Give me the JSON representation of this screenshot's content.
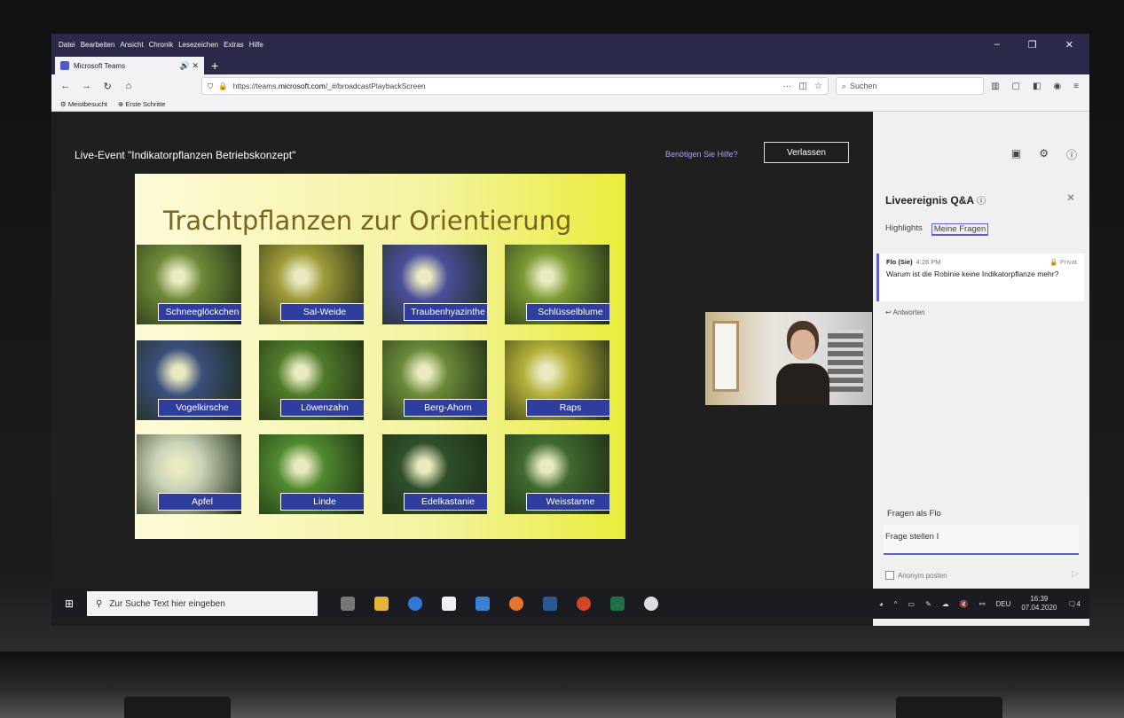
{
  "menu": [
    "Datei",
    "Bearbeiten",
    "Ansicht",
    "Chronik",
    "Lesezeichen",
    "Extras",
    "Hilfe"
  ],
  "window_controls": [
    "–",
    "❐",
    "✕"
  ],
  "tab": {
    "title": "Microsoft Teams",
    "new_tab": "+"
  },
  "nav": {
    "url_prefix": "https://teams.",
    "url_bold": "microsoft.com",
    "url_suffix": "/_#/broadcastPlaybackScreen",
    "search_placeholder": "Suchen"
  },
  "bookmarks": [
    "Meistbesucht",
    "Erste Schritte"
  ],
  "event": {
    "title": "Live-Event \"Indikatorpflanzen Betriebskonzept\"",
    "help": "Benötigen Sie Hilfe?",
    "leave": "Verlassen"
  },
  "slide": {
    "title": "Trachtpflanzen zur Orientierung",
    "tiles": [
      {
        "label": "Schneeglöckchen",
        "color": "#6f8a3a"
      },
      {
        "label": "Sal-Weide",
        "color": "#9e9a3a"
      },
      {
        "label": "Traubenhyazinthe",
        "color": "#4a4f9a"
      },
      {
        "label": "Schlüsselblume",
        "color": "#7c9a35"
      },
      {
        "label": "Vogelkirsche",
        "color": "#3a4f7a"
      },
      {
        "label": "Löwenzahn",
        "color": "#4f7a2a"
      },
      {
        "label": "Berg-Ahorn",
        "color": "#6a8a3a"
      },
      {
        "label": "Raps",
        "color": "#b4b03a"
      },
      {
        "label": "Apfel",
        "color": "#c9d3b8"
      },
      {
        "label": "Linde",
        "color": "#4f8a2f"
      },
      {
        "label": "Edelkastanie",
        "color": "#2f4f2a"
      },
      {
        "label": "Weisstanne",
        "color": "#3f6a2f"
      }
    ]
  },
  "qa": {
    "title": "Liveereignis Q&A",
    "tabs": [
      "Highlights",
      "Meine Fragen"
    ],
    "question": {
      "author": "Flo (Sie)",
      "time": "4:28 PM",
      "visibility": "Privat",
      "text": "Warum ist die Robinie keine Indikatorpflanze mehr?"
    },
    "reply": "Antworten",
    "ask_as": "Fragen als Flo",
    "ask_placeholder": "Frage stellen",
    "anonymous": "Anonym posten"
  },
  "taskbar": {
    "search_placeholder": "Zur Suche Text hier eingeben",
    "language": "DEU",
    "time": "16:39",
    "date": "07.04.2020",
    "notifications": "4"
  }
}
